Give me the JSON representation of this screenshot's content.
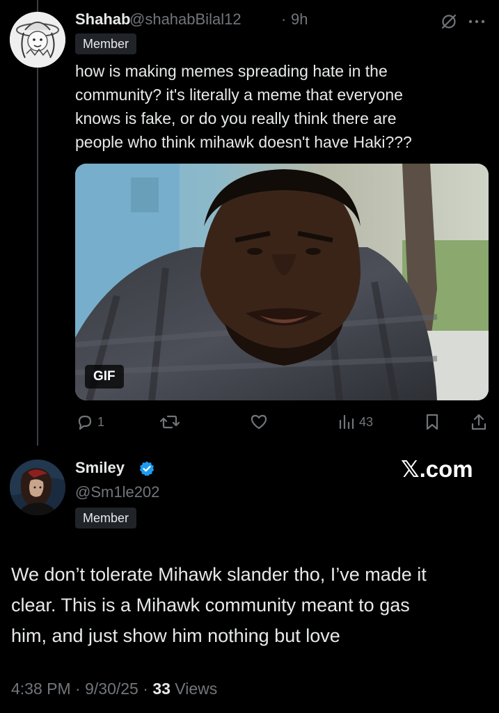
{
  "colors": {
    "background": "#000000",
    "text_primary": "#e7e9ea",
    "text_secondary": "#71767b",
    "verified_blue": "#1d9bf0",
    "badge_bg": "#202327"
  },
  "reply": {
    "author_name": "Shahab",
    "handle": "@shahabBilal12",
    "separator": "·",
    "time": "9h",
    "badge": "Member",
    "text": "how is making memes spreading hate in the\ncommunity? it's literally a meme that everyone\nknows is fake, or do you really think there are\npeople who think mihawk doesn't have Haki???",
    "media_badge": "GIF",
    "icons": {
      "grok": "slashed-circle-icon",
      "more": "more-dots-icon",
      "reply": "reply-icon",
      "repost": "repost-icon",
      "like": "heart-icon",
      "views": "bar-chart-icon",
      "bookmark": "bookmark-icon",
      "share": "share-icon"
    },
    "actions": {
      "replies": "1",
      "views": "43"
    }
  },
  "main_post": {
    "author_name": "Smiley",
    "verified": true,
    "handle": "@Sm1le202",
    "badge": "Member",
    "watermark": "𝕏.com",
    "text": "We don’t tolerate Mihawk slander tho, I’ve made it\nclear. This is a Mihawk community meant to gas\nhim, and just show him nothing but love",
    "time": "4:38 PM",
    "sep1": "·",
    "date": "9/30/25",
    "sep2": "·",
    "views_count": "33",
    "views_label": "Views"
  }
}
